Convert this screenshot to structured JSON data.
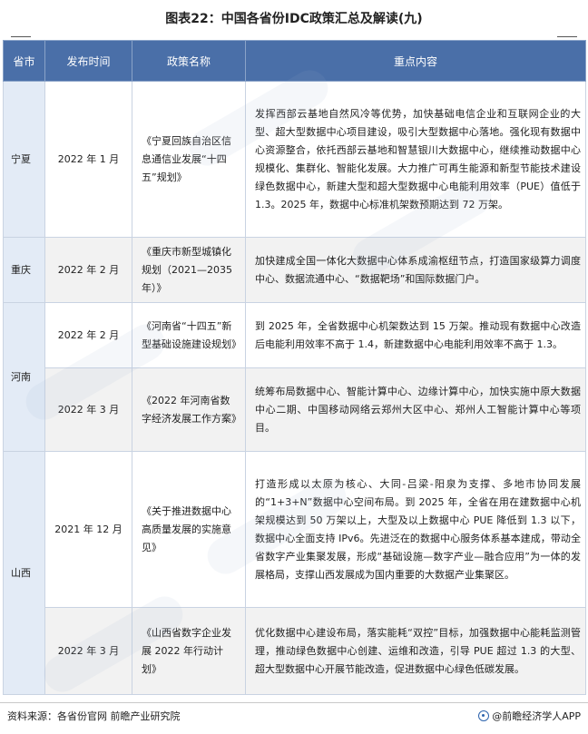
{
  "title": "图表22：中国各省份IDC政策汇总及解读(九)",
  "headers": [
    "省市",
    "发布时间",
    "政策名称",
    "重点内容"
  ],
  "rows": [
    {
      "province": "宁夏",
      "date": "2022 年 1 月",
      "policy": "《宁夏回族自治区信息通信业发展“十四五”规划》",
      "content": "发挥西部云基地自然风冷等优势，加快基础电信企业和互联网企业的大型、超大型数据中心项目建设，吸引大型数据中心落地。强化现有数据中心资源整合，依托西部云基地和智慧银川大数据中心，继续推动数据中心规模化、集群化、智能化发展。大力推广可再生能源和新型节能技术建设绿色数据中心，新建大型和超大型数据中心电能利用效率（PUE）值低于 1.3。2025 年，数据中心标准机架数预期达到 72 万架。"
    },
    {
      "province": "重庆",
      "date": "2022 年 2 月",
      "policy": "《重庆市新型城镇化规划（2021—2035 年）》",
      "content": "加快建成全国一体化大数据中心体系成渝枢纽节点，打造国家级算力调度中心、数据流通中心、“数据靶场”和国际数据门户。"
    },
    {
      "province": "河南",
      "date": "2022 年 2 月",
      "policy": "《河南省“十四五”新型基础设施建设规划》",
      "content": "到 2025 年，全省数据中心机架数达到 15 万架。推动现有数据中心改造后电能利用效率不高于 1.4，新建数据中心电能利用效率不高于 1.3。"
    },
    {
      "province": "",
      "date": "2022 年 3 月",
      "policy": "《2022 年河南省数字经济发展工作方案》",
      "content": "统筹布局数据中心、智能计算中心、边缘计算中心，加快实施中原大数据中心二期、中国移动网络云郑州大区中心、郑州人工智能计算中心等项目。"
    },
    {
      "province": "山西",
      "date": "2021 年 12 月",
      "policy": "《关于推进数据中心高质量发展的实施意见》",
      "content": "打造形成以太原为核心、大同-吕梁-阳泉为支撑、多地市协同发展的“1+3+N”数据中心空间布局。到 2025 年，全省在用在建数据中心机架规模达到 50 万架以上，大型及以上数据中心 PUE 降低到 1.3 以下，数据中心全面支持 IPv6。先进泛在的数据中心服务体系基本建成，带动全省数字产业集聚发展，形成“基础设施—数字产业—融合应用”为一体的发展格局，支撑山西发展成为国内重要的大数据产业集聚区。"
    },
    {
      "province": "",
      "date": "2022 年 3 月",
      "policy": "《山西省数字企业发展 2022 年行动计划》",
      "content": "优化数据中心建设布局，落实能耗“双控”目标，加强数据中心能耗监测管理，推动绿色数据中心创建、运维和改造，引导 PUE 超过 1.3 的大型、超大型数据中心开展节能改造，促进数据中心绿色低碳发展。"
    }
  ],
  "footer": {
    "source": "资料来源：各省份官网 前瞻产业研究院",
    "brand": "@前瞻经济学人APP",
    "brand_icon": "qianzhan-logo-icon"
  },
  "colors": {
    "header_bg": "#4a6fa8",
    "province_bg": "#e3ebf6",
    "alt_row_bg": "#f2f2f2"
  }
}
